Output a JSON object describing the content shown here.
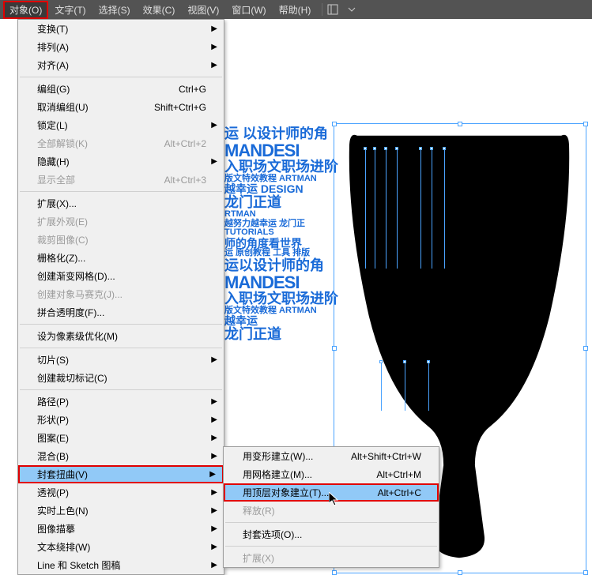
{
  "menubar": {
    "items": [
      "对象(O)",
      "文字(T)",
      "选择(S)",
      "效果(C)",
      "视图(V)",
      "窗口(W)",
      "帮助(H)"
    ]
  },
  "menu": {
    "transform": "变换(T)",
    "arrange": "排列(A)",
    "align": "对齐(A)",
    "group": "编组(G)",
    "group_sc": "Ctrl+G",
    "ungroup": "取消编组(U)",
    "ungroup_sc": "Shift+Ctrl+G",
    "lock": "锁定(L)",
    "unlock_all": "全部解锁(K)",
    "unlock_all_sc": "Alt+Ctrl+2",
    "hide": "隐藏(H)",
    "show_all": "显示全部",
    "show_all_sc": "Alt+Ctrl+3",
    "expand": "扩展(X)...",
    "expand_appearance": "扩展外观(E)",
    "crop_image": "裁剪图像(C)",
    "rasterize": "栅格化(Z)...",
    "gradient_mesh": "创建渐变网格(D)...",
    "object_mosaic": "创建对象马赛克(J)...",
    "flatten_trans": "拼合透明度(F)...",
    "pixel_perfect": "设为像素级优化(M)",
    "slice": "切片(S)",
    "trim_marks": "创建裁切标记(C)",
    "path": "路径(P)",
    "shape": "形状(P)",
    "pattern": "图案(E)",
    "blend": "混合(B)",
    "envelope": "封套扭曲(V)",
    "perspective": "透视(P)",
    "live_paint": "实时上色(N)",
    "image_trace": "图像描摹",
    "text_wrap": "文本绕排(W)",
    "line_sketch": "Line 和 Sketch 图稿"
  },
  "submenu": {
    "make_warp": "用变形建立(W)...",
    "make_warp_sc": "Alt+Shift+Ctrl+W",
    "make_mesh": "用网格建立(M)...",
    "make_mesh_sc": "Alt+Ctrl+M",
    "make_top": "用顶层对象建立(T)...",
    "make_top_sc": "Alt+Ctrl+C",
    "release": "释放(R)",
    "options": "封套选项(O)...",
    "expand": "扩展(X)"
  },
  "canvas_text": {
    "l1": "运 以设计师的角",
    "l2": "MANDESI",
    "l3": "入职场文职场进阶",
    "l4": "版文特效教程 ARTMAN",
    "l5": "越幸运 DESIGN",
    "l6": "龙门正道",
    "l7": "RTMAN",
    "l8": "越努力越幸运 龙门正",
    "l9": "TUTORIALS",
    "l10": "师的角度看世界",
    "l11": "运 原创教程 工具 排版",
    "l12": "运以设计师的角",
    "l13": "MANDESI",
    "l14": "入职场文职场进阶",
    "l15": "版文特效教程 ARTMAN",
    "l16": "越幸运",
    "l17": "龙门正道"
  }
}
